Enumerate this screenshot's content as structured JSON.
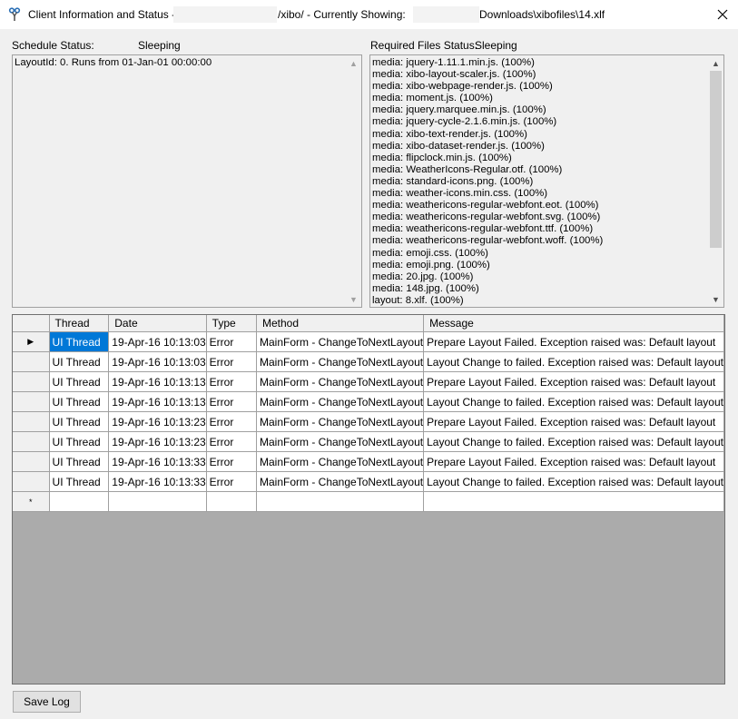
{
  "window": {
    "title_prefix": "Client Information and Status -",
    "title_middle": "/xibo/ - Currently Showing:",
    "title_suffix": "Downloads\\xibofiles\\14.xlf"
  },
  "schedule": {
    "label": "Schedule Status:",
    "value": "Sleeping",
    "lines": [
      "LayoutId: 0. Runs from 01-Jan-01 00:00:00"
    ]
  },
  "required_files": {
    "label": "Required Files Status:",
    "value": "Sleeping",
    "lines": [
      "media: jquery-1.11.1.min.js. (100%)",
      "media: xibo-layout-scaler.js. (100%)",
      "media: xibo-webpage-render.js. (100%)",
      "media: moment.js. (100%)",
      "media: jquery.marquee.min.js. (100%)",
      "media: jquery-cycle-2.1.6.min.js. (100%)",
      "media: xibo-text-render.js. (100%)",
      "media: xibo-dataset-render.js. (100%)",
      "media: flipclock.min.js. (100%)",
      "media: WeatherIcons-Regular.otf. (100%)",
      "media: standard-icons.png. (100%)",
      "media: weather-icons.min.css. (100%)",
      "media: weathericons-regular-webfont.eot. (100%)",
      "media: weathericons-regular-webfont.svg. (100%)",
      "media: weathericons-regular-webfont.ttf. (100%)",
      "media: weathericons-regular-webfont.woff. (100%)",
      "media: emoji.css. (100%)",
      "media: emoji.png. (100%)",
      "media: 20.jpg. (100%)",
      "media: 148.jpg. (100%)",
      "layout: 8.xlf. (100%)"
    ]
  },
  "log": {
    "columns": [
      "Thread",
      "Date",
      "Type",
      "Method",
      "Message"
    ],
    "rows": [
      [
        "UI Thread",
        "19-Apr-16 10:13:03",
        "Error",
        "MainForm - ChangeToNextLayout",
        "Prepare Layout Failed. Exception raised was: Default layout"
      ],
      [
        "UI Thread",
        "19-Apr-16 10:13:03",
        "Error",
        "MainForm - ChangeToNextLayout",
        "Layout Change to  failed. Exception raised was: Default layout"
      ],
      [
        "UI Thread",
        "19-Apr-16 10:13:13",
        "Error",
        "MainForm - ChangeToNextLayout",
        "Prepare Layout Failed. Exception raised was: Default layout"
      ],
      [
        "UI Thread",
        "19-Apr-16 10:13:13",
        "Error",
        "MainForm - ChangeToNextLayout",
        "Layout Change to  failed. Exception raised was: Default layout"
      ],
      [
        "UI Thread",
        "19-Apr-16 10:13:23",
        "Error",
        "MainForm - ChangeToNextLayout",
        "Prepare Layout Failed. Exception raised was: Default layout"
      ],
      [
        "UI Thread",
        "19-Apr-16 10:13:23",
        "Error",
        "MainForm - ChangeToNextLayout",
        "Layout Change to  failed. Exception raised was: Default layout"
      ],
      [
        "UI Thread",
        "19-Apr-16 10:13:33",
        "Error",
        "MainForm - ChangeToNextLayout",
        "Prepare Layout Failed. Exception raised was: Default layout"
      ],
      [
        "UI Thread",
        "19-Apr-16 10:13:33",
        "Error",
        "MainForm - ChangeToNextLayout",
        "Layout Change to  failed. Exception raised was: Default layout"
      ]
    ],
    "new_row_marker": "*",
    "current_row_marker": "▶"
  },
  "buttons": {
    "save_log": "Save Log"
  },
  "icons": {
    "app": "xibo-app-icon",
    "close": "close-icon",
    "scroll_up": "scroll-up-arrow-icon",
    "scroll_down": "scroll-down-arrow-icon"
  },
  "colors": {
    "selection": "#0078d7",
    "grid_background": "#ababab",
    "window": "#f0f0f0"
  }
}
